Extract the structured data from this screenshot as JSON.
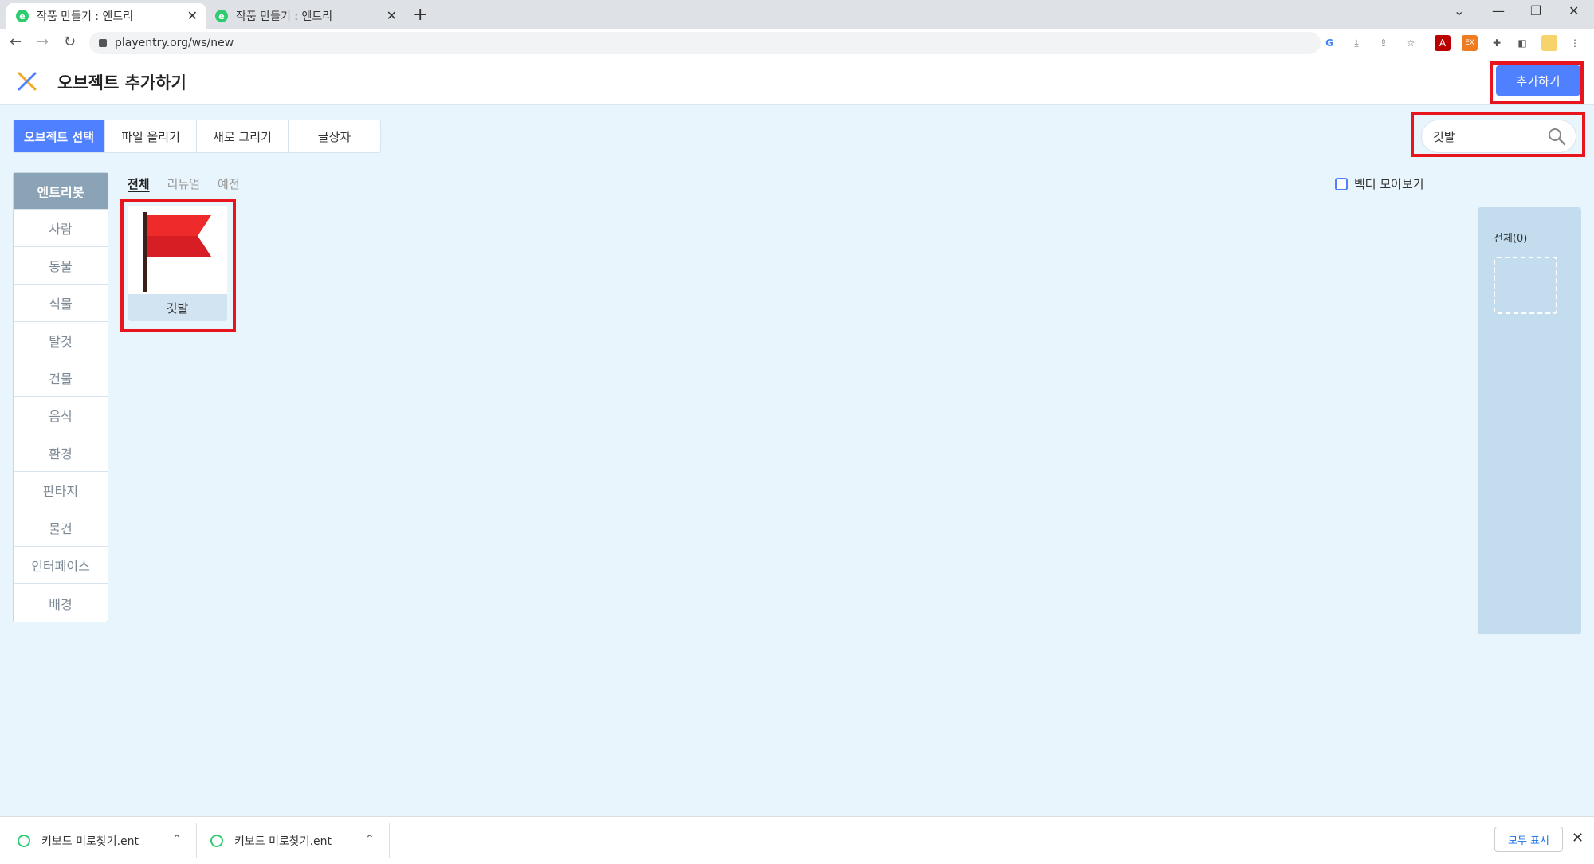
{
  "browser": {
    "tabs": [
      {
        "title": "작품 만들기 : 엔트리",
        "favicon": "e"
      },
      {
        "title": "작품 만들기 : 엔트리",
        "favicon": "e"
      }
    ],
    "url": "playentry.org/ws/new"
  },
  "header": {
    "title": "오브젝트 추가하기",
    "add_button": "추가하기",
    "accent": "#4f80ff"
  },
  "source_tabs": [
    "오브젝트 선택",
    "파일 올리기",
    "새로 그리기",
    "글상자"
  ],
  "search": {
    "value": "깃발"
  },
  "categories": [
    "엔트리봇",
    "사람",
    "동물",
    "식물",
    "탈것",
    "건물",
    "음식",
    "환경",
    "판타지",
    "물건",
    "인터페이스",
    "배경"
  ],
  "style_tabs": [
    "전체",
    "리뉴얼",
    "예전"
  ],
  "vector_toggle": {
    "label": "벡터 모아보기",
    "checked": false
  },
  "results": [
    {
      "name": "깃발",
      "icon": "red-flag"
    }
  ],
  "selected_panel": {
    "label": "전체(0)"
  },
  "downloads": {
    "items": [
      "키보드 미로찾기.ent",
      "키보드 미로찾기.ent"
    ],
    "show_all": "모두 표시"
  }
}
